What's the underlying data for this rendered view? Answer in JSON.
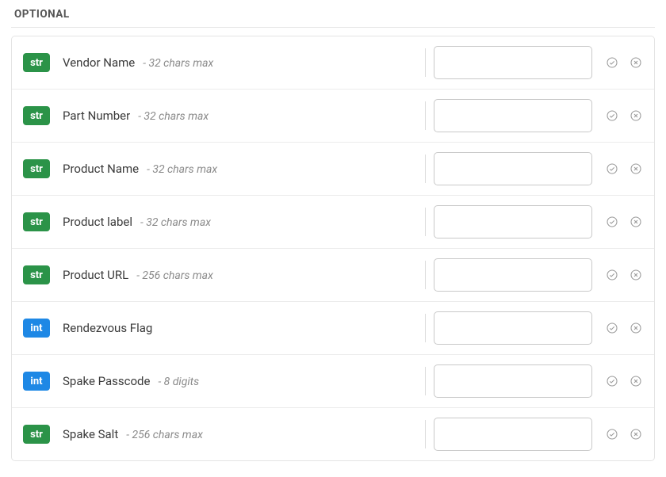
{
  "section": {
    "title": "OPTIONAL"
  },
  "types": {
    "str": "str",
    "int": "int"
  },
  "fields": [
    {
      "type": "str",
      "label": "Vendor Name",
      "hint": "32 chars max",
      "value": ""
    },
    {
      "type": "str",
      "label": "Part Number",
      "hint": "32 chars max",
      "value": ""
    },
    {
      "type": "str",
      "label": "Product Name",
      "hint": "32 chars max",
      "value": ""
    },
    {
      "type": "str",
      "label": "Product label",
      "hint": "32 chars max",
      "value": ""
    },
    {
      "type": "str",
      "label": "Product URL",
      "hint": "256 chars max",
      "value": ""
    },
    {
      "type": "int",
      "label": "Rendezvous Flag",
      "hint": "",
      "value": ""
    },
    {
      "type": "int",
      "label": "Spake Passcode",
      "hint": "8 digits",
      "value": ""
    },
    {
      "type": "str",
      "label": "Spake Salt",
      "hint": "256 chars max",
      "value": ""
    }
  ]
}
